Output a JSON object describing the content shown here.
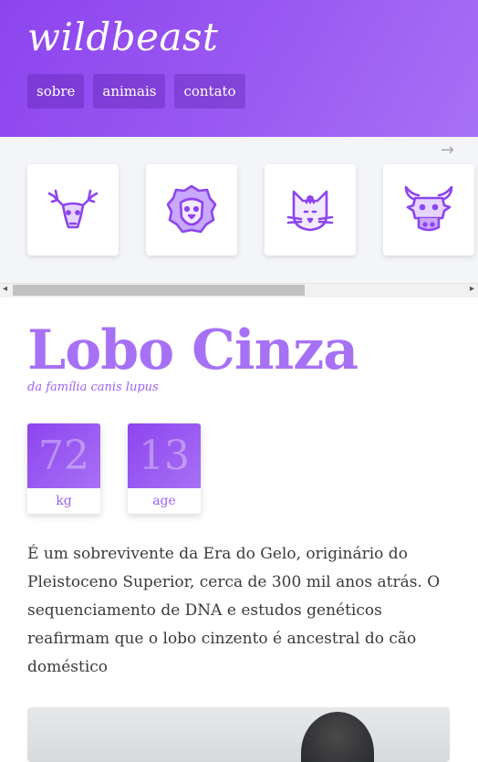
{
  "brand": "wildbeast",
  "nav": [
    "sobre",
    "animais",
    "contato"
  ],
  "carousel": {
    "next_arrow": "→",
    "items": [
      {
        "icon": "deer-icon"
      },
      {
        "icon": "lion-icon"
      },
      {
        "icon": "cat-icon"
      },
      {
        "icon": "bull-icon"
      }
    ]
  },
  "animal": {
    "name": "Lobo Cinza",
    "family": "da família canis lupus",
    "stats": [
      {
        "value": "72",
        "label": "kg"
      },
      {
        "value": "13",
        "label": "age"
      }
    ],
    "description": "É um sobrevivente da Era do Gelo, originário do Pleistoceno Superior, cerca de 300 mil anos atrás. O sequenciamento de DNA e estudos genéticos reafirmam que o lobo cinzento é ancestral do cão doméstico"
  },
  "colors": {
    "primary": "#8d44ee",
    "accent": "#a771f5"
  }
}
